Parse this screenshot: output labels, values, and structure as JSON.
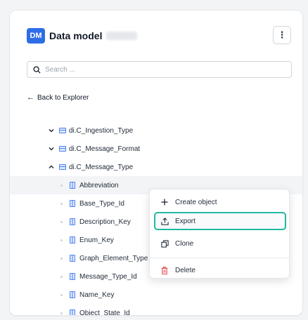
{
  "header": {
    "badge": "DM",
    "title": "Data model",
    "menu_icon": "kebab-vertical-icon"
  },
  "search": {
    "placeholder": "Search ..."
  },
  "back_link": {
    "label": "Back to Explorer"
  },
  "tree": {
    "tables": [
      {
        "label": "di.C_Ingestion_Type",
        "state": "expanded-chevron-down"
      },
      {
        "label": "di.C_Message_Format",
        "state": "expanded-chevron-down"
      },
      {
        "label": "di.C_Message_Type",
        "state": "expanded-chevron-up"
      }
    ],
    "columns": [
      {
        "label": "Abbreviation",
        "selected": true
      },
      {
        "label": "Base_Type_Id"
      },
      {
        "label": "Description_Key"
      },
      {
        "label": "Enum_Key"
      },
      {
        "label": "Graph_Element_Type"
      },
      {
        "label": "Message_Type_Id"
      },
      {
        "label": "Name_Key"
      },
      {
        "label": "Object_State_Id"
      }
    ]
  },
  "context_menu": {
    "items": [
      {
        "label": "Create object",
        "icon": "plus-icon"
      },
      {
        "label": "Export",
        "icon": "export-icon",
        "highlighted": true
      },
      {
        "label": "Clone",
        "icon": "clone-icon"
      },
      {
        "label": "Delete",
        "icon": "trash-icon",
        "icon_color": "#e5484d"
      }
    ]
  },
  "colors": {
    "accent": "#2d6de6",
    "highlight_border": "#22b8a0",
    "delete_icon": "#e5484d"
  }
}
